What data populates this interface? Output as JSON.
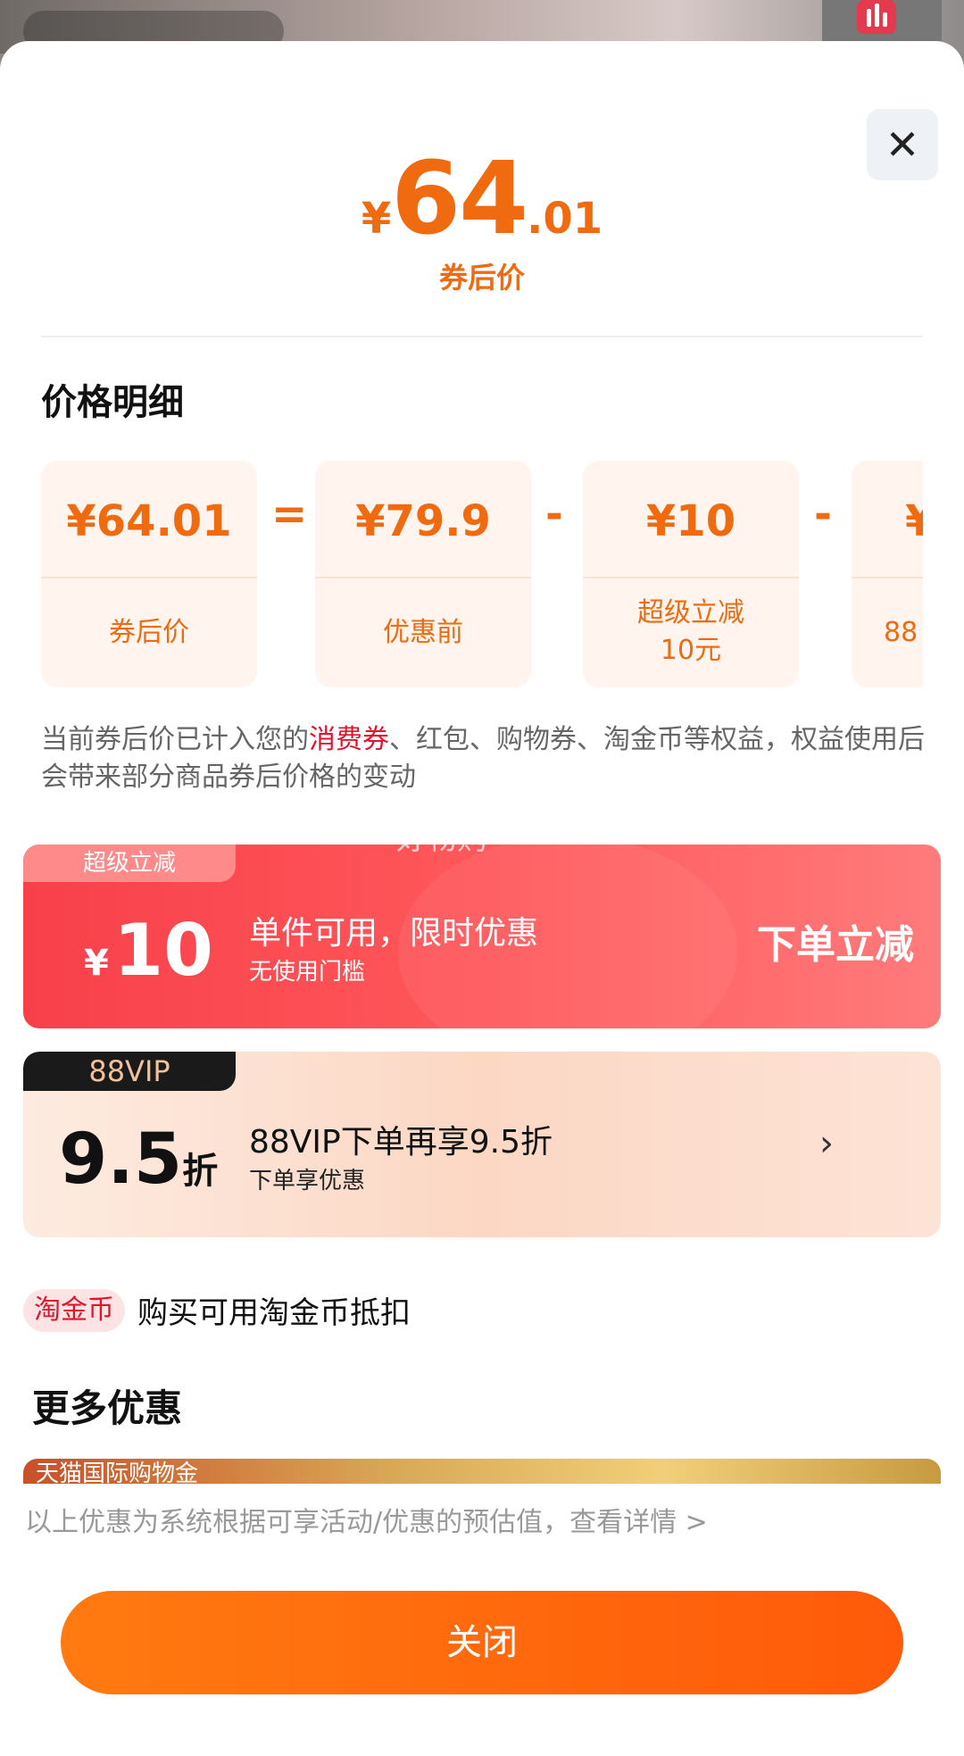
{
  "hero": {
    "currency": "¥",
    "integer": "64",
    "decimal": ".01",
    "label": "券后价"
  },
  "breakdown": {
    "title": "价格明细",
    "cards": [
      {
        "amount": "¥64.01",
        "label": "券后价"
      },
      {
        "amount": "¥79.9",
        "label": "优惠前"
      },
      {
        "amount": "¥10",
        "label": "超级立减\n10元"
      },
      {
        "amount": "¥",
        "label": "88"
      }
    ],
    "operators": [
      "=",
      "-",
      "-"
    ]
  },
  "note": {
    "pre": "当前券后价已计入您的",
    "highlight": "消费券",
    "post": "、红包、购物券、淘金币等权益，权益使用后会带来部分商品券后价格的变动"
  },
  "watermark": "好物购",
  "super_discount": {
    "tag": "超级立减",
    "currency": "¥",
    "amount": "10",
    "title": "单件可用，限时优惠",
    "subtitle": "无使用门槛",
    "cta": "下单立减"
  },
  "vip": {
    "tag": "88VIP",
    "value": "9.5",
    "unit": "折",
    "title": "88VIP下单再享9.5折",
    "subtitle": "下单享优惠",
    "chevron": "›"
  },
  "coin": {
    "badge": "淘金币",
    "text": "购买可用淘金币抵扣"
  },
  "more": {
    "title": "更多优惠",
    "tmall_label": "天猫国际购物金"
  },
  "disclaimer": "以上优惠为系统根据可享活动/优惠的预估值，查看详情 >",
  "close_button": "关闭",
  "close_icon": "✕",
  "colors": {
    "accent": "#f06a10",
    "red": "#f8404a",
    "highlight": "#e4132d"
  }
}
